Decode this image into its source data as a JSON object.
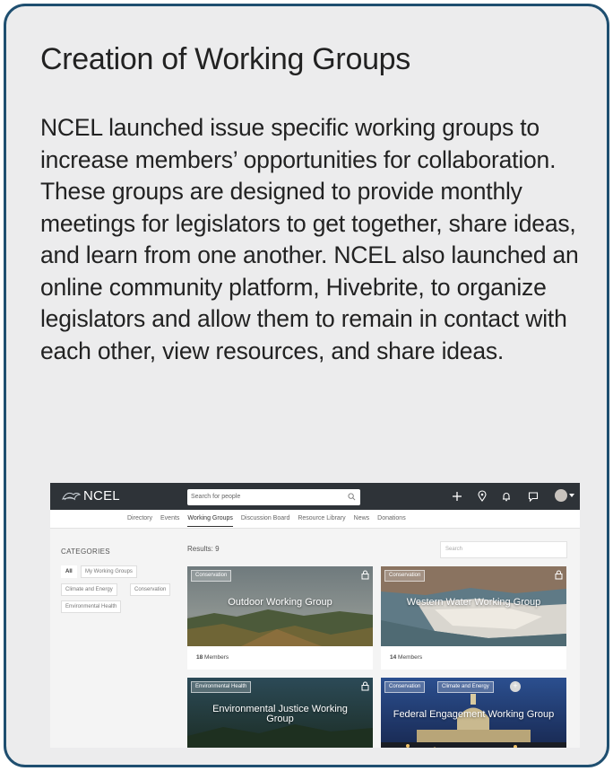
{
  "card": {
    "title": "Creation of Working Groups",
    "body": "NCEL launched issue specific working groups to increase members’ opportunities for collaboration. These groups are designed to provide monthly meetings for legislators to get together, share ideas, and learn from one another. NCEL also launched an online community platform, Hivebrite, to organize legislators and allow them to remain in contact with each other, view resources, and share ideas."
  },
  "app": {
    "logo": "NCEL",
    "search_placeholder": "Search for people",
    "nav": [
      "Directory",
      "Events",
      "Working Groups",
      "Discussion Board",
      "Resource Library",
      "News",
      "Donations"
    ],
    "active_nav": "Working Groups",
    "categories_title": "CATEGORIES",
    "categories": [
      "All",
      "My Working Groups",
      "Climate and Energy",
      "Conservation",
      "Environmental Health"
    ],
    "results_label": "Results: 9",
    "filter_placeholder": "Search",
    "groups": [
      {
        "name": "Outdoor Working Group",
        "tags": [
          "Conservation"
        ],
        "members": "18",
        "members_label": "Members"
      },
      {
        "name": "Western Water Working Group",
        "tags": [
          "Conservation"
        ],
        "members": "14",
        "members_label": "Members"
      },
      {
        "name": "Environmental Justice Working Group",
        "tags": [
          "Environmental Health"
        ]
      },
      {
        "name": "Federal Engagement Working Group",
        "tags": [
          "Conservation",
          "Climate and Energy"
        ]
      }
    ],
    "icons": [
      "plus-icon",
      "location-pin-icon",
      "bell-icon",
      "chat-icon",
      "avatar",
      "lock-icon"
    ],
    "colors": {
      "border": "#1f4f70",
      "topbar": "#2e3338",
      "card_bg": "#ececed"
    }
  }
}
